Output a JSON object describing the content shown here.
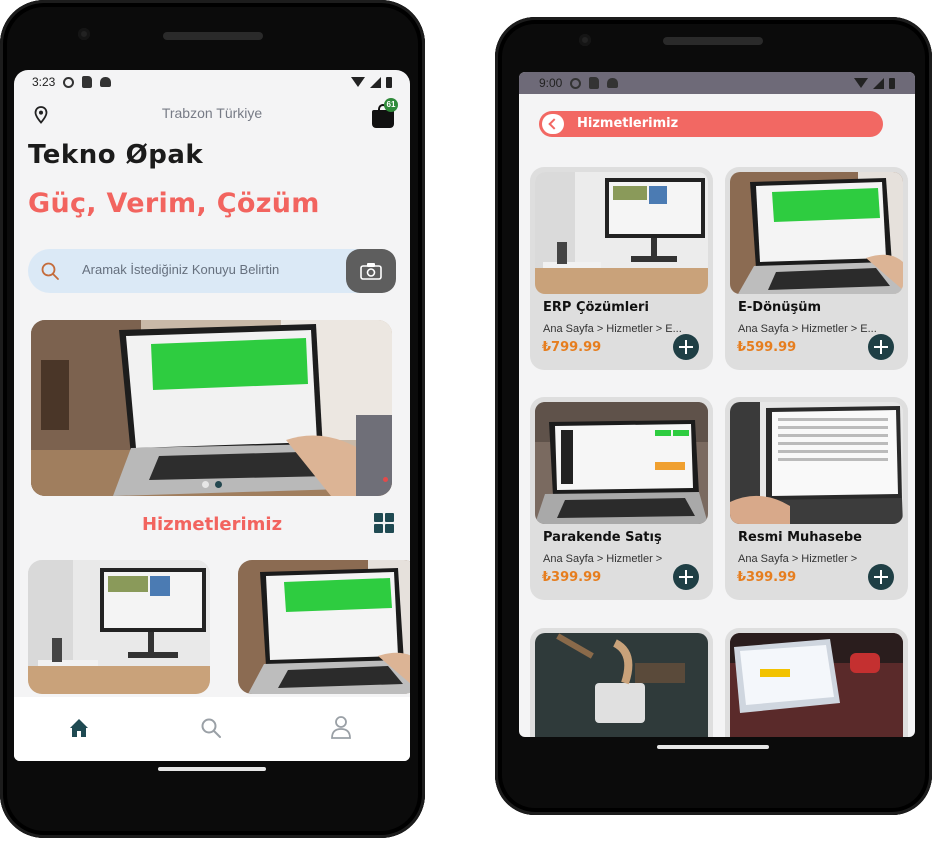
{
  "colors": {
    "accent": "#f2645f",
    "dark_teal": "#1f3f45",
    "price": "#e67e1f",
    "search_bg": "#dbe9f6",
    "screen_bg": "#f4f4f5"
  },
  "phone1": {
    "status": {
      "time": "3:23"
    },
    "location": "Trabzon Türkiye",
    "cart_badge": "61",
    "brand": "Tekno Øpak",
    "slogan": "Güç, Verim, Çözüm",
    "search": {
      "placeholder": "Aramak İstediğiniz Konuyu Belirtin"
    },
    "banner": {
      "dots": 2,
      "active_dot": 2
    },
    "section_title": "Hizmetlerimiz",
    "nav": [
      "home-icon",
      "search-icon",
      "profile-icon"
    ]
  },
  "phone2": {
    "status": {
      "time": "9:00"
    },
    "header_title": "Hizmetlerimiz",
    "services": [
      {
        "name": "ERP Çözümleri",
        "crumb": "Ana Sayfa > Hizmetler > E...",
        "price": "₺799.99"
      },
      {
        "name": "E-Dönüşüm",
        "crumb": "Ana Sayfa > Hizmetler > E...",
        "price": "₺599.99"
      },
      {
        "name": "Parakende Satış",
        "crumb": "Ana Sayfa > Hizmetler >",
        "price": "₺399.99"
      },
      {
        "name": "Resmi Muhasebe",
        "crumb": "Ana Sayfa > Hizmetler >",
        "price": "₺399.99"
      }
    ]
  }
}
